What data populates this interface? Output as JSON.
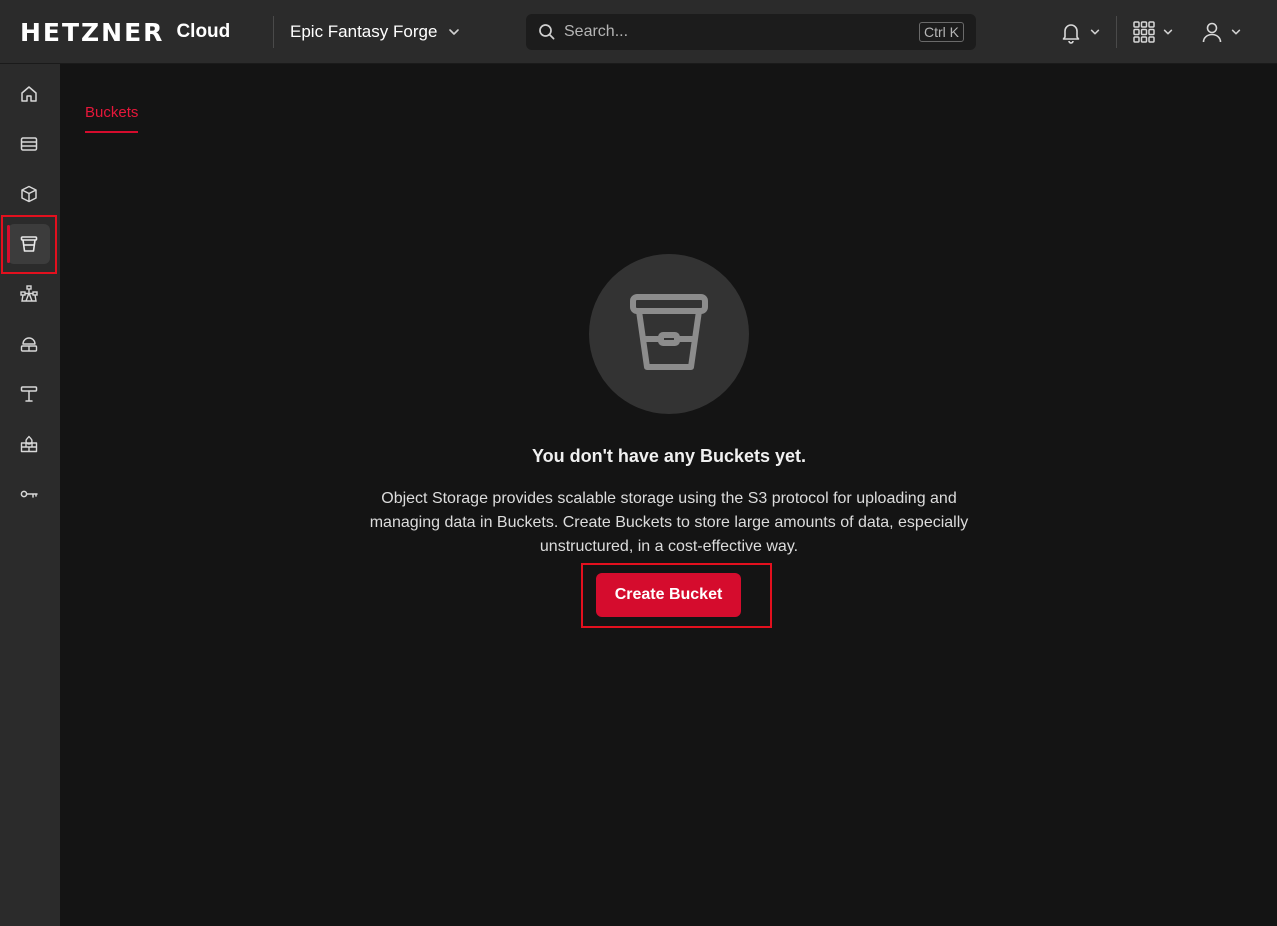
{
  "header": {
    "logo_text": "HETZNER",
    "logo_sub": "Cloud",
    "project_name": "Epic Fantasy Forge",
    "search": {
      "placeholder": "Search...",
      "shortcut": "Ctrl K"
    },
    "icons": [
      "bell-icon",
      "apps-grid-icon",
      "user-icon"
    ]
  },
  "sidebar": {
    "items": [
      {
        "name": "home",
        "icon": "home-icon",
        "active": false
      },
      {
        "name": "servers",
        "icon": "server-icon",
        "active": false
      },
      {
        "name": "volumes",
        "icon": "cube-icon",
        "active": false
      },
      {
        "name": "object-storage",
        "icon": "bucket-icon",
        "active": true
      },
      {
        "name": "networks",
        "icon": "network-icon",
        "active": false
      },
      {
        "name": "load-balancers",
        "icon": "load-balancer-icon",
        "active": false
      },
      {
        "name": "floating-ips",
        "icon": "floating-ip-icon",
        "active": false
      },
      {
        "name": "firewalls",
        "icon": "firewall-icon",
        "active": false
      },
      {
        "name": "security",
        "icon": "key-icon",
        "active": false
      }
    ]
  },
  "main": {
    "tabs": [
      {
        "label": "Buckets",
        "active": true
      }
    ],
    "empty_state": {
      "icon": "bucket-icon",
      "title": "You don't have any Buckets yet.",
      "description": "Object Storage provides scalable storage using the S3 protocol for uploading and managing data in Buckets. Create Buckets to store large amounts of data, especially unstructured, in a cost-effective way.",
      "button_label": "Create Bucket"
    }
  },
  "colors": {
    "accent": "#d50c2d",
    "background": "#141414",
    "panel": "#2b2b2b"
  }
}
